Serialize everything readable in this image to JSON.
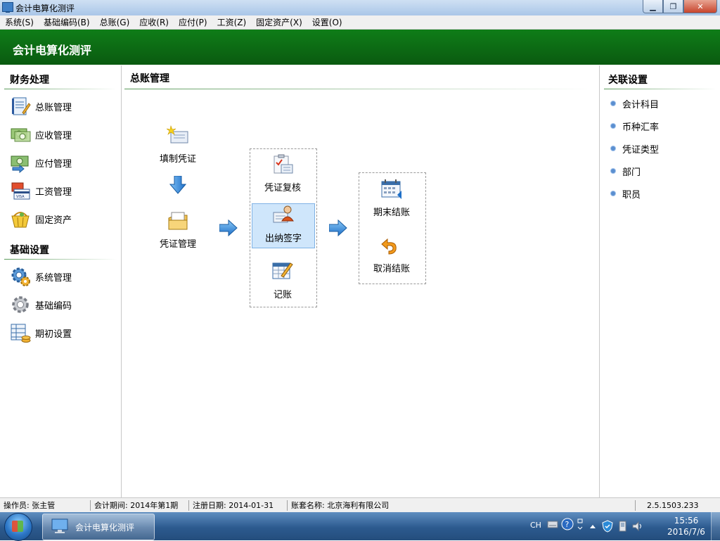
{
  "window": {
    "title": "会计电算化测评",
    "min": "▁",
    "max": "❐",
    "close": "✕"
  },
  "menu": [
    {
      "label": "系统(S)"
    },
    {
      "label": "基础编码(B)"
    },
    {
      "label": "总账(G)"
    },
    {
      "label": "应收(R)"
    },
    {
      "label": "应付(P)"
    },
    {
      "label": "工资(Z)"
    },
    {
      "label": "固定资产(X)"
    },
    {
      "label": "设置(O)"
    }
  ],
  "banner": {
    "title": "会计电算化测评"
  },
  "left": {
    "section1": "财务处理",
    "items1": [
      {
        "label": "总账管理",
        "icon": "ledger-icon"
      },
      {
        "label": "应收管理",
        "icon": "money-in-icon"
      },
      {
        "label": "应付管理",
        "icon": "money-out-icon"
      },
      {
        "label": "工资管理",
        "icon": "salary-card-icon"
      },
      {
        "label": "固定资产",
        "icon": "asset-basket-icon"
      }
    ],
    "section2": "基础设置",
    "items2": [
      {
        "label": "系统管理",
        "icon": "gear-icon"
      },
      {
        "label": "基础编码",
        "icon": "cog-gray-icon"
      },
      {
        "label": "期初设置",
        "icon": "table-coins-icon"
      }
    ]
  },
  "center": {
    "title": "总账管理",
    "nodes": {
      "fill_voucher": "填制凭证",
      "voucher_manage": "凭证管理",
      "voucher_review": "凭证复核",
      "cashier_sign": "出纳签字",
      "post": "记账",
      "period_close": "期末结账",
      "cancel_close": "取消结账"
    }
  },
  "right": {
    "title": "关联设置",
    "links": [
      {
        "label": "会计科目"
      },
      {
        "label": "币种汇率"
      },
      {
        "label": "凭证类型"
      },
      {
        "label": "部门"
      },
      {
        "label": "职员"
      }
    ]
  },
  "status": {
    "operator": "操作员: 张主管",
    "period": "会计期间: 2014年第1期",
    "reg_date": "注册日期: 2014-01-31",
    "account": "账套名称: 北京海利有限公司",
    "version": "2.5.1503.233"
  },
  "taskbar": {
    "task_label": "会计电算化测评",
    "lang": "CH",
    "time": "15:56",
    "date": "2016/7/6"
  },
  "colors": {
    "banner": "#0a6412",
    "selected": "#cfe6fb"
  }
}
